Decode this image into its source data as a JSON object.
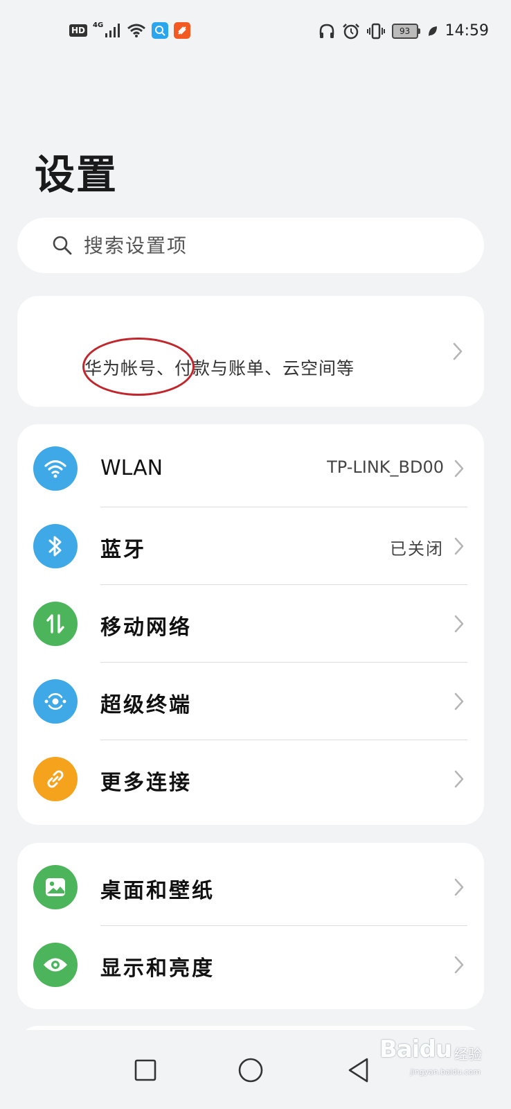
{
  "status_bar": {
    "hd_badge": "HD",
    "network_type": "4G",
    "battery_level": "93",
    "time": "14:59",
    "icons": [
      "signal-icon",
      "wifi-icon",
      "search-app-icon",
      "app-notification-icon",
      "headphones-icon",
      "alarm-icon",
      "vibrate-icon",
      "battery-icon",
      "eco-leaf-icon"
    ]
  },
  "page": {
    "title": "设置"
  },
  "search": {
    "placeholder": "搜索设置项"
  },
  "account": {
    "subtitle": "华为帐号、付款与账单、云空间等"
  },
  "connectivity": {
    "items": [
      {
        "label": "WLAN",
        "value": "TP-LINK_BD00",
        "icon": "wifi-icon",
        "color": "#3fa9e8"
      },
      {
        "label": "蓝牙",
        "value": "已关闭",
        "icon": "bluetooth-icon",
        "color": "#3fa9e8"
      },
      {
        "label": "移动网络",
        "value": "",
        "icon": "mobile-data-icon",
        "color": "#4cb45a"
      },
      {
        "label": "超级终端",
        "value": "",
        "icon": "super-device-icon",
        "color": "#3fa9e8"
      },
      {
        "label": "更多连接",
        "value": "",
        "icon": "link-icon",
        "color": "#f5a21d"
      }
    ]
  },
  "display": {
    "items": [
      {
        "label": "桌面和壁纸",
        "icon": "wallpaper-icon",
        "color": "#4cb45a"
      },
      {
        "label": "显示和亮度",
        "icon": "eye-icon",
        "color": "#4cb45a"
      }
    ]
  },
  "navigation": {
    "buttons": [
      "recent-apps",
      "home",
      "back"
    ]
  },
  "watermark": {
    "brand": "Baidu",
    "text": "经验",
    "url": "jingyan.baidu.com"
  }
}
